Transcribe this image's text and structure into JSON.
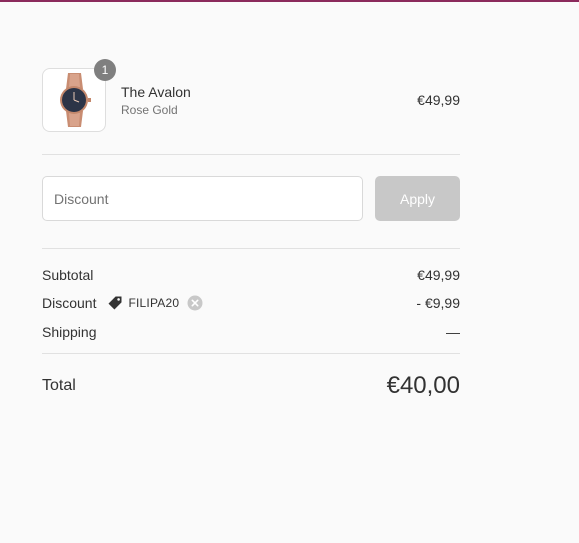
{
  "product": {
    "name": "The Avalon",
    "variant": "Rose Gold",
    "price": "€49,99",
    "quantity": "1"
  },
  "discount": {
    "placeholder": "Discount",
    "apply_label": "Apply"
  },
  "totals": {
    "subtotal_label": "Subtotal",
    "subtotal_value": "€49,99",
    "discount_label": "Discount",
    "discount_code": "FILIPA20",
    "discount_value": "- €9,99",
    "shipping_label": "Shipping",
    "shipping_value": "—",
    "total_label": "Total",
    "total_value": "€40,00"
  },
  "colors": {
    "accent_border": "#8b2a5c",
    "apply_button": "#c8c8c8",
    "badge": "#7f7f7f"
  },
  "icons": {
    "tag": "tag-icon",
    "remove": "close-circle-icon",
    "product_image": "watch-image"
  }
}
